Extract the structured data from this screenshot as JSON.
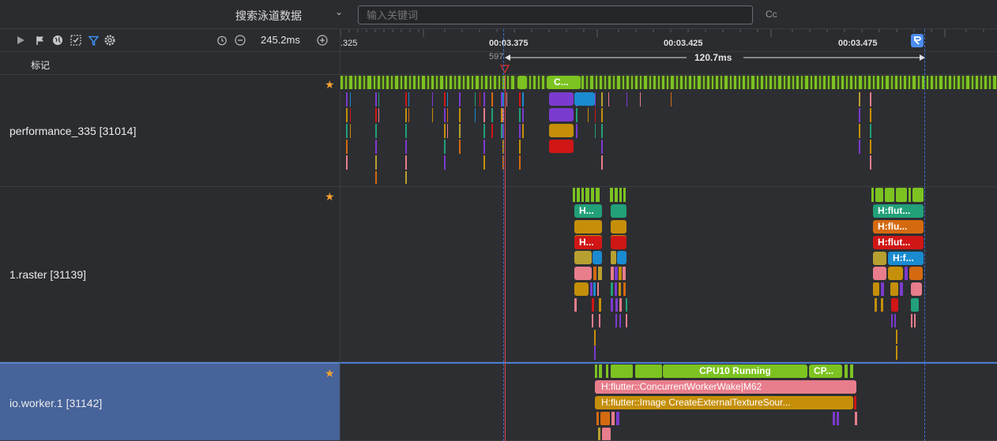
{
  "search": {
    "scope_label": "搜索泳道数据",
    "placeholder": "输入关键词",
    "case_label": "Cc"
  },
  "toolbar": {
    "icons": [
      "play-icon",
      "flag-icon",
      "globe-icon",
      "select-area-icon",
      "filter-icon",
      "settings-icon"
    ],
    "zoom_value": "245.2ms"
  },
  "marker_row": {
    "label": "标记"
  },
  "ruler": {
    "ticks": [
      ".325",
      "00:03.375",
      "00:03.425",
      "00:03.475"
    ],
    "cursor_label": "597",
    "range_label": "120.7ms"
  },
  "lanes": [
    {
      "name": "performance_335 [31014]",
      "slices": [
        "C..."
      ]
    },
    {
      "name": "1.raster [31139]",
      "slices": [
        "H...",
        "H...",
        "H:flut...",
        "H:flu...",
        "H:flut...",
        "H:f..."
      ]
    },
    {
      "name": "io.worker.1 [31142]",
      "selected": true,
      "slices": [
        "CPU10 Running",
        "CP...",
        "H:flutter::ConcurrentWorkerWake|M62",
        "H:flutter::Image CreateExternalTextureSour..."
      ]
    }
  ],
  "colors": {
    "green": "#7cc321",
    "purple": "#7b3bcf",
    "blue": "#1a8bd0",
    "gold": "#c58f0a",
    "red": "#d01616",
    "teal": "#22a07a",
    "pink": "#e87d8c",
    "orange": "#d46a10",
    "olive": "#b8a030",
    "selected_lane": "#46639a",
    "star": "#f0a033"
  }
}
